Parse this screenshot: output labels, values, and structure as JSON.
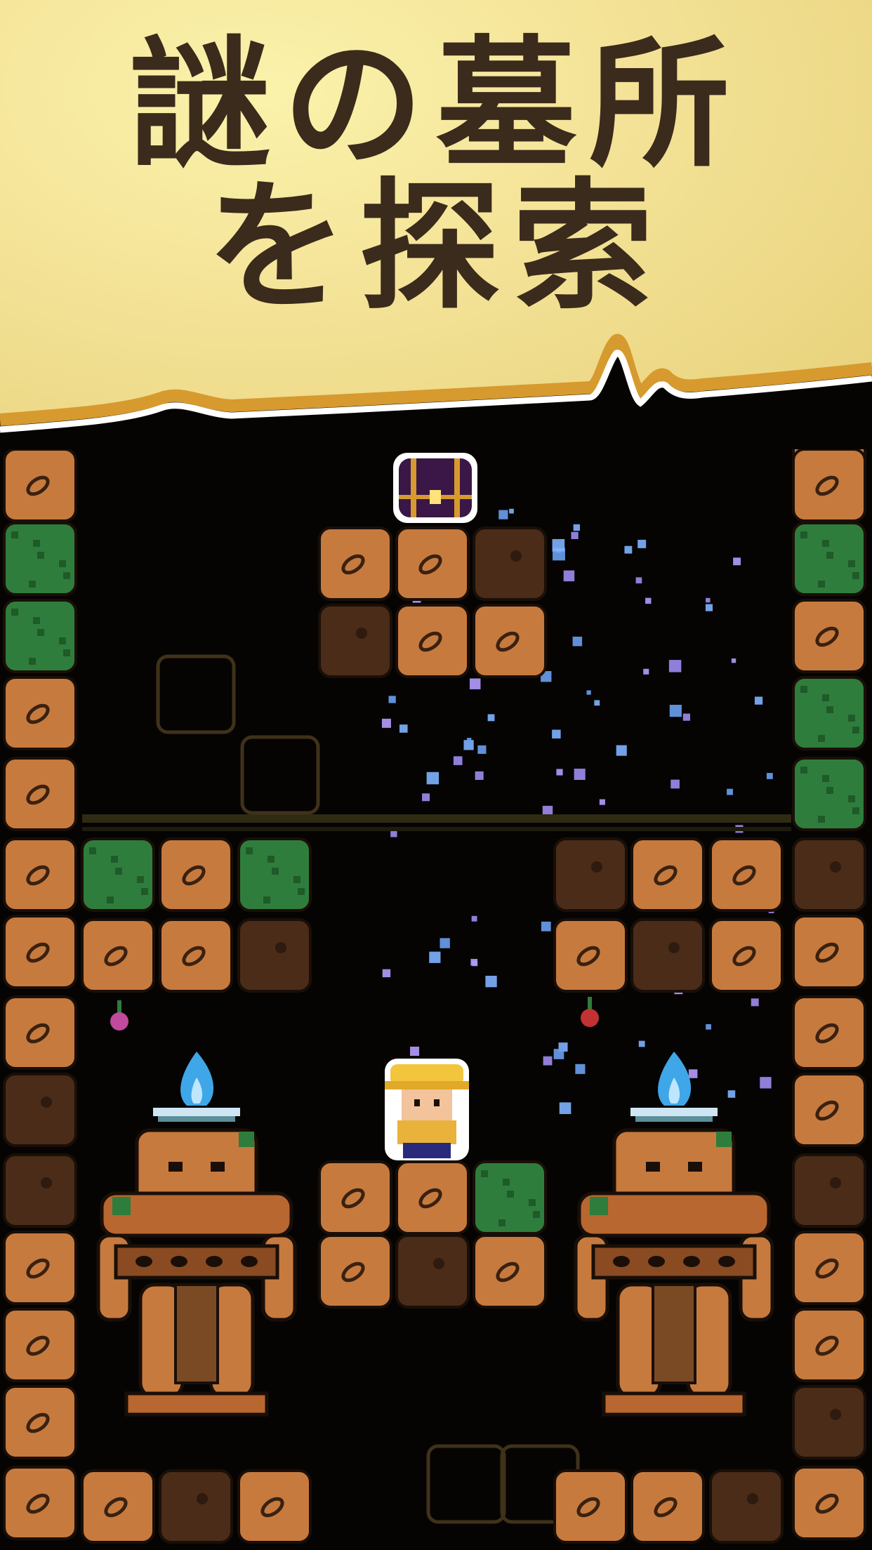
{
  "banner": {
    "title_line1": "謎の墓所",
    "title_line2": "を探索"
  },
  "colors": {
    "banner_light": "#fbf2ab",
    "banner_dark": "#e6cf77",
    "title_text": "#3b2b1c",
    "border_gold": "#d79a2e",
    "dirt": "#c77a3e",
    "dirt_dark": "#4a2c18",
    "moss": "#2f7d3c",
    "flame": "#3fa6e8",
    "background": "#050403"
  },
  "icons": {
    "chest": "treasure-chest-icon",
    "player": "explorer-character-icon",
    "statue": "stone-guardian-statue-icon",
    "flame": "blue-flame-brazier-icon",
    "berry": "hanging-berry-icon"
  }
}
